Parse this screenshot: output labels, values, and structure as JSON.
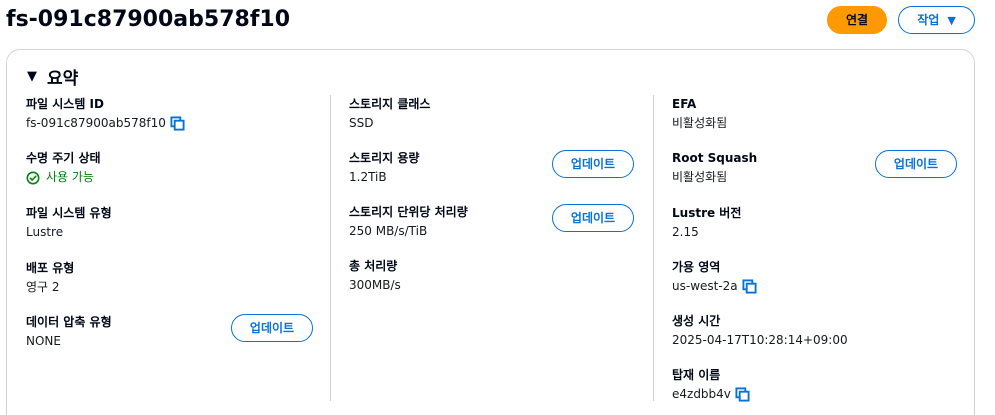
{
  "header": {
    "title": "fs-091c87900ab578f10",
    "connect_label": "연결",
    "actions_label": "작업"
  },
  "summary": {
    "title": "요약",
    "col1": {
      "fs_id_label": "파일 시스템 ID",
      "fs_id_value": "fs-091c87900ab578f10",
      "lifecycle_label": "수명 주기 상태",
      "lifecycle_value": "사용 가능",
      "fs_type_label": "파일 시스템 유형",
      "fs_type_value": "Lustre",
      "deploy_type_label": "배포 유형",
      "deploy_type_value": "영구 2",
      "compression_label": "데이터 압축 유형",
      "compression_value": "NONE",
      "compression_update": "업데이트"
    },
    "col2": {
      "storage_class_label": "스토리지 클래스",
      "storage_class_value": "SSD",
      "storage_capacity_label": "스토리지 용량",
      "storage_capacity_value": "1.2TiB",
      "storage_capacity_update": "업데이트",
      "throughput_per_unit_label": "스토리지 단위당 처리량",
      "throughput_per_unit_value": "250 MB/s/TiB",
      "throughput_per_unit_update": "업데이트",
      "total_throughput_label": "총 처리량",
      "total_throughput_value": "300MB/s"
    },
    "col3": {
      "efa_label": "EFA",
      "efa_value": "비활성화됨",
      "root_squash_label": "Root Squash",
      "root_squash_value": "비활성화됨",
      "root_squash_update": "업데이트",
      "lustre_version_label": "Lustre 버전",
      "lustre_version_value": "2.15",
      "az_label": "가용 영역",
      "az_value": "us-west-2a",
      "created_label": "생성 시간",
      "created_value": "2025-04-17T10:28:14+09:00",
      "mount_label": "탑재 이름",
      "mount_value": "e4zdbb4v"
    }
  },
  "colors": {
    "primary": "#ff9900",
    "link": "#0972d3",
    "success": "#037f0c",
    "border": "#d1d5db"
  },
  "icons": {
    "copy": "copy-icon",
    "status_ok": "status-positive-icon",
    "actions_caret": "caret-down-icon",
    "expand": "caret-down-filled-icon"
  }
}
